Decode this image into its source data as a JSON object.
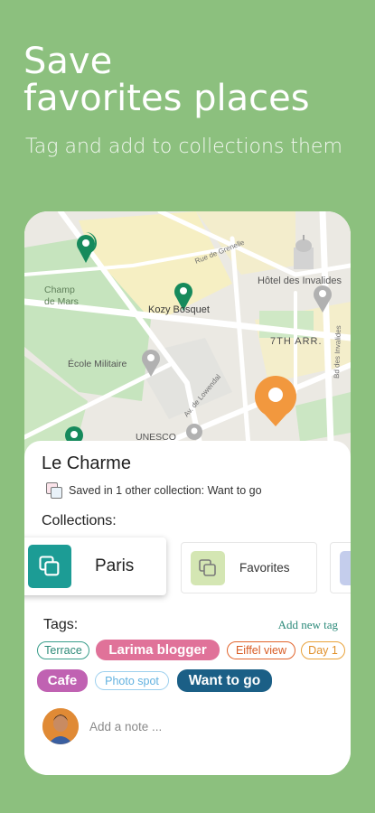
{
  "hero": {
    "title_line1": "Save",
    "title_line2": "favorites places",
    "subtitle": "Tag and add to collections them"
  },
  "map": {
    "labels": {
      "rue": "Rue de Grenelle",
      "champ": "Champ",
      "de_mars": "de Mars",
      "kozy": "Kozy Bosquet",
      "hotel": "Hôtel des Invalides",
      "arr": "7TH ARR.",
      "ecole": "École Militaire",
      "lowendal": "Av. de Lowendal",
      "unesco": "UNESCO",
      "bd": "Bd des Invalides"
    }
  },
  "place": {
    "name": "Le Charme",
    "saved_text": "Saved in 1 other collection: Want to go"
  },
  "collections": {
    "label": "Collections:",
    "items": [
      {
        "name": "Paris",
        "color": "#1c9c95"
      },
      {
        "name": "Favorites",
        "color": "#d4e6b3"
      },
      {
        "name": "",
        "color": "#c4cdec"
      }
    ]
  },
  "tags": {
    "label": "Tags:",
    "add_label": "Add new tag",
    "items": [
      {
        "text": "Terrace",
        "style": "outline",
        "color": "#3a9e8b"
      },
      {
        "text": "Larima blogger",
        "style": "filled",
        "color": "#e07299"
      },
      {
        "text": "Eiffel view",
        "style": "outline",
        "color": "#e2642c"
      },
      {
        "text": "Day 1",
        "style": "outline",
        "color": "#e9a23a"
      },
      {
        "text": "Cafe",
        "style": "filled",
        "color": "#c062b2"
      },
      {
        "text": "Photo spot",
        "style": "outline",
        "color": "#7ec0e8"
      },
      {
        "text": "Want to go",
        "style": "filled",
        "color": "#1b5f86"
      }
    ]
  },
  "note": {
    "placeholder": "Add a note ..."
  }
}
